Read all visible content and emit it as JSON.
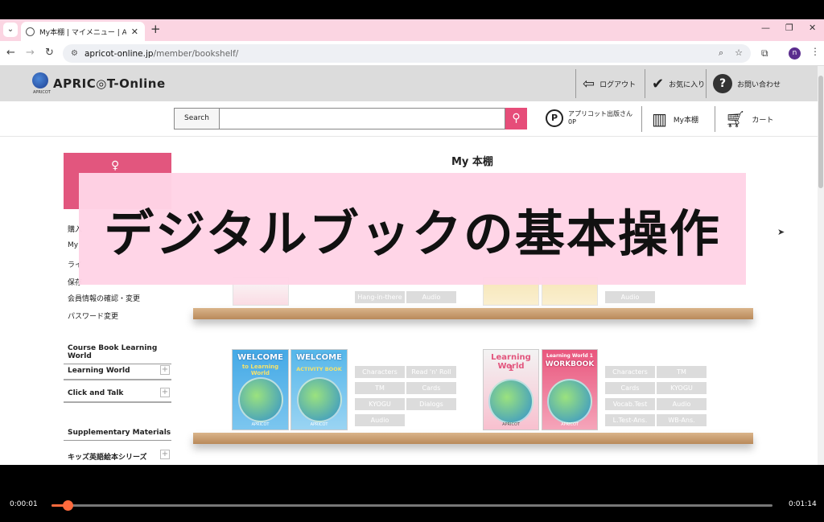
{
  "browser": {
    "tab_title": "My本棚 | マイメニュー | APRICOT-O",
    "url_host": "apricot-online.jp",
    "url_path": "/member/bookshelf/",
    "profile_initial": "n"
  },
  "header": {
    "logo_sub": "APRICOT",
    "logo_text": "APRIC◎T-Online",
    "logout_label": "ログアウト",
    "favorites_label": "お気に入り",
    "contact_label": "お問い合わせ"
  },
  "search": {
    "label": "Search",
    "value": "",
    "points_line1": "アプリコット出版さん",
    "points_line2": "0P",
    "bookshelf_label": "My本棚",
    "cart_label": "カート"
  },
  "sidebar": {
    "links": [
      "購入",
      "My",
      "ライ",
      "保存",
      "会員情報の確認・変更",
      "パスワード変更"
    ],
    "section1": "Course Book Learning World",
    "acc1": [
      "Learning World",
      "Click and Talk"
    ],
    "section2": "Supplementary Materials",
    "acc2": [
      "キッズ英語絵本シリーズ"
    ]
  },
  "main": {
    "title": "My 本棚",
    "shelf1_buttons_left": [
      "Hang-in-there",
      "Audio"
    ],
    "shelf1_buttons_right": [
      "Audio"
    ],
    "books": {
      "welcome_title": "WELCOME",
      "welcome_sub": "to Learning World",
      "activity_title": "WELCOME",
      "activity_sub": "ACTIVITY BOOK",
      "lw_title": "Learning World",
      "lw_num": "1",
      "wb_title": "Learning World 1",
      "wb_sub": "WORKBOOK",
      "tag": "APRICOT"
    },
    "welcome_buttons": [
      "Characters",
      "Read 'n' Roll",
      "TM",
      "Cards",
      "KYOGU",
      "Dialogs",
      "Audio"
    ],
    "lw_buttons": [
      "Characters",
      "TM",
      "Cards",
      "KYOGU",
      "Vocab.Test",
      "Audio",
      "L.Test-Ans.",
      "WB-Ans."
    ]
  },
  "overlay": {
    "text": "デジタルブックの基本操作"
  },
  "player": {
    "current": "0:00:01",
    "total": "0:01:14",
    "progress": 0.022
  }
}
